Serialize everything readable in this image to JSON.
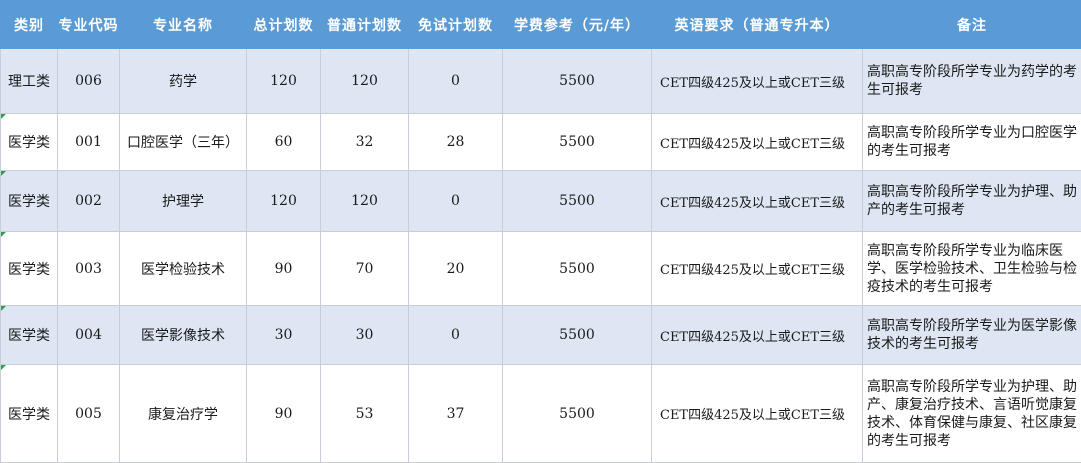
{
  "headers": [
    "类别",
    "专业代码",
    "专业名称",
    "总计划数",
    "普通计划数",
    "免试计划数",
    "学费参考（元/年）",
    "英语要求（普通专升本）",
    "备注"
  ],
  "rows": [
    {
      "category": "理工类",
      "code": "006",
      "name": "药学",
      "total": "120",
      "regular": "120",
      "exempt": "0",
      "fee": "5500",
      "english": "CET四级425及以上或CET三级",
      "note": "高职高专阶段所学专业为药学的考生可报考"
    },
    {
      "category": "医学类",
      "code": "001",
      "name": "口腔医学（三年）",
      "total": "60",
      "regular": "32",
      "exempt": "28",
      "fee": "5500",
      "english": "CET四级425及以上或CET三级",
      "note": "高职高专阶段所学专业为口腔医学的考生可报考"
    },
    {
      "category": "医学类",
      "code": "002",
      "name": "护理学",
      "total": "120",
      "regular": "120",
      "exempt": "0",
      "fee": "5500",
      "english": "CET四级425及以上或CET三级",
      "note": "高职高专阶段所学专业为护理、助产的考生可报考"
    },
    {
      "category": "医学类",
      "code": "003",
      "name": "医学检验技术",
      "total": "90",
      "regular": "70",
      "exempt": "20",
      "fee": "5500",
      "english": "CET四级425及以上或CET三级",
      "note": "高职高专阶段所学专业为临床医学、医学检验技术、卫生检验与检疫技术的考生可报考"
    },
    {
      "category": "医学类",
      "code": "004",
      "name": "医学影像技术",
      "total": "30",
      "regular": "30",
      "exempt": "0",
      "fee": "5500",
      "english": "CET四级425及以上或CET三级",
      "note": "高职高专阶段所学专业为医学影像技术的考生可报考"
    },
    {
      "category": "医学类",
      "code": "005",
      "name": "康复治疗学",
      "total": "90",
      "regular": "53",
      "exempt": "37",
      "fee": "5500",
      "english": "CET四级425及以上或CET三级",
      "note": "高职高专阶段所学专业为护理、助产、康复治疗技术、言语听觉康复技术、体育保健与康复、社区康复的考生可报考"
    }
  ]
}
